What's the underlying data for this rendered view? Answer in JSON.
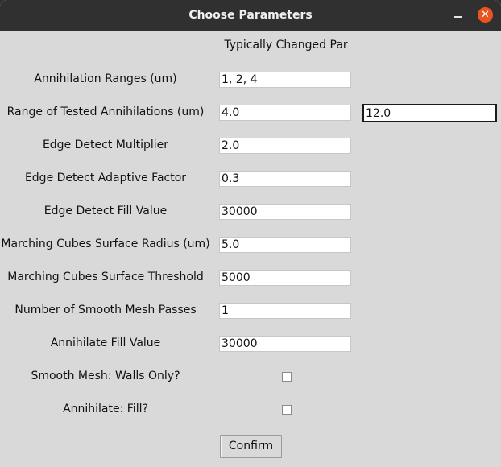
{
  "window": {
    "title": "Choose Parameters",
    "close_glyph": "✕"
  },
  "section_header": "Typically Changed Par",
  "params": [
    {
      "label": "Annihilation Ranges (um)",
      "value": "1, 2, 4"
    },
    {
      "label": "Range of Tested Annihilations (um)",
      "value": "4.0",
      "value2": "12.0"
    },
    {
      "label": "Edge Detect Multiplier",
      "value": "2.0"
    },
    {
      "label": "Edge Detect Adaptive Factor",
      "value": "0.3"
    },
    {
      "label": "Edge Detect Fill Value",
      "value": "30000"
    },
    {
      "label": "Marching Cubes Surface Radius (um)",
      "value": "5.0"
    },
    {
      "label": "Marching Cubes Surface Threshold",
      "value": "5000"
    },
    {
      "label": "Number of Smooth Mesh Passes",
      "value": "1"
    },
    {
      "label": "Annihilate Fill Value",
      "value": "30000"
    }
  ],
  "checkboxes": [
    {
      "label": "Smooth Mesh: Walls Only?",
      "checked": false
    },
    {
      "label": "Annihilate: Fill?",
      "checked": false
    }
  ],
  "confirm_label": "Confirm",
  "colors": {
    "titlebar": "#303030",
    "background": "#d9d9d9",
    "close_button": "#e95420"
  }
}
